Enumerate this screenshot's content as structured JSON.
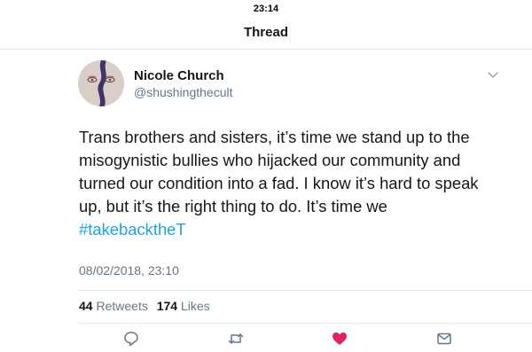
{
  "status_bar": {
    "time": "23:14"
  },
  "nav": {
    "title": "Thread"
  },
  "tweet": {
    "author_name": "Nicole Church",
    "author_handle": "@shushingthecult",
    "text_line_1": "Trans brothers and sisters, it’s time we stand up to the",
    "text_line_2": "misogynistic bullies who hijacked our community and",
    "text_line_3": "turned our condition into a fad. I know it’s hard to speak",
    "text_line_4": "up, but it’s the right thing to do. It’s time we",
    "hashtag": "#takebacktheT",
    "timestamp": "08/02/2018, 23:10",
    "retweet_count": "44",
    "retweet_label": "Retweets",
    "like_count": "174",
    "like_label": "Likes"
  },
  "actions": {
    "reply_icon": "reply-icon",
    "retweet_icon": "retweet-icon",
    "like_icon": "heart-icon",
    "dm_icon": "mail-icon",
    "like_color": "#e0245e",
    "icon_color": "#657786"
  },
  "colors": {
    "link": "#1da1f2",
    "muted": "#657786",
    "text": "#14171a"
  }
}
